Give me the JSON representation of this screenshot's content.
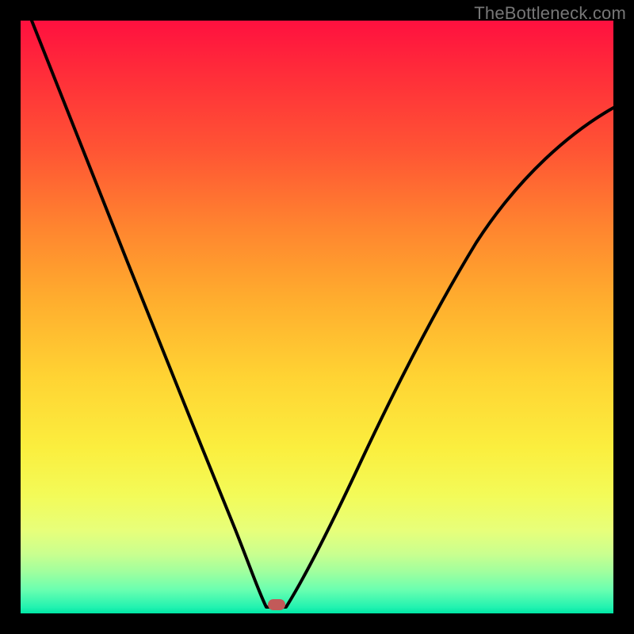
{
  "watermark": "TheBottleneck.com",
  "chart_data": {
    "type": "line",
    "title": "",
    "xlabel": "",
    "ylabel": "",
    "xlim": [
      0,
      100
    ],
    "ylim": [
      0,
      100
    ],
    "grid": false,
    "legend": false,
    "series": [
      {
        "name": "bottleneck-curve",
        "x": [
          0,
          5,
          10,
          15,
          20,
          25,
          30,
          35,
          40,
          42,
          45,
          50,
          55,
          60,
          65,
          70,
          75,
          80,
          85,
          90,
          95,
          100
        ],
        "y": [
          100,
          90,
          80,
          70,
          60,
          49,
          38,
          25,
          10,
          2,
          2,
          10,
          22,
          34,
          44,
          52,
          60,
          66,
          72,
          76,
          80,
          83
        ]
      }
    ],
    "annotations": [
      {
        "type": "marker",
        "shape": "pill",
        "x": 43,
        "y": 1,
        "color": "#c25a59"
      }
    ],
    "background_gradient": {
      "top": "#ff103f",
      "bottom": "#00e6a5"
    }
  }
}
